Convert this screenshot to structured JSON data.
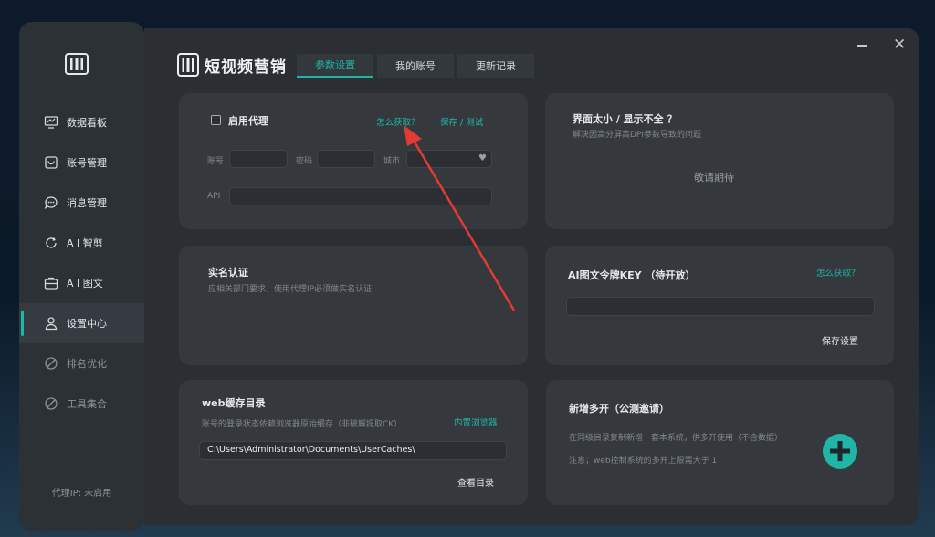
{
  "sidebar": {
    "items": [
      {
        "label": "数据看板",
        "icon": "dashboard-icon"
      },
      {
        "label": "账号管理",
        "icon": "account-icon"
      },
      {
        "label": "消息管理",
        "icon": "message-icon"
      },
      {
        "label": "A I 智剪",
        "icon": "ai-clip-icon"
      },
      {
        "label": "A I 图文",
        "icon": "ai-image-text-icon"
      },
      {
        "label": "设置中心",
        "icon": "settings-user-icon",
        "active": true
      },
      {
        "label": "排名优化",
        "icon": "disabled-icon"
      },
      {
        "label": "工具集合",
        "icon": "disabled-icon"
      }
    ],
    "proxy_status": "代理IP: 未启用"
  },
  "header": {
    "brand": "短视频营销",
    "tabs": [
      "参数设置",
      "我的账号",
      "更新记录"
    ],
    "active_tab": 0
  },
  "proxy_card": {
    "enable_label": "启用代理",
    "how_link": "怎么获取？",
    "save_test_link": "保存 / 测试",
    "account_label": "账号",
    "password_label": "密码",
    "city_label": "城市",
    "api_label": "API"
  },
  "display_card": {
    "title": "界面太小 / 显示不全 ？",
    "subtitle": "解决因高分屏高DPI参数导致的问题",
    "placeholder": "敬请期待"
  },
  "realname_card": {
    "title": "实名认证",
    "subtitle": "应相关部门要求，使用代理IP必须做实名认证"
  },
  "ai_key_card": {
    "title": "AI图文令牌KEY （待开放）",
    "how_link": "怎么获取？",
    "save_button": "保存设置"
  },
  "cache_card": {
    "title": "web缓存目录",
    "subtitle": "账号的登录状态依赖浏览器原始缓存（非破解提取CK）",
    "browser_link": "内置浏览器",
    "path_value": "C:\\Users\\Administrator\\Documents\\UserCaches\\",
    "view_button": "查看目录"
  },
  "multi_card": {
    "title": "新增多开（公测邀请）",
    "desc1": "在同级目录复制新增一套本系统，供多开使用（不含数据）",
    "desc2": "注意；web控制系统的多开上限需大于 1"
  },
  "colors": {
    "accent": "#1fb6a8",
    "annotation_arrow": "#e53935"
  }
}
